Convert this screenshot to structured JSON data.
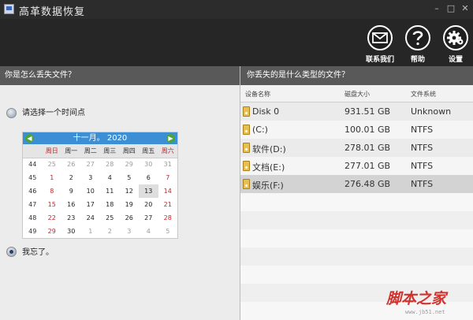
{
  "app": {
    "title": "高革数据恢复"
  },
  "window": {
    "minimize": "–",
    "maximize": "□",
    "close": "✕"
  },
  "toolbar": [
    {
      "id": "contact",
      "label": "联系我们",
      "icon": "mail-icon"
    },
    {
      "id": "help",
      "label": "帮助",
      "icon": "help-icon"
    },
    {
      "id": "settings",
      "label": "设置",
      "icon": "gear-icon"
    }
  ],
  "left_header": "你是怎么丢失文件？",
  "right_header": "你丢失的是什么类型的文件？",
  "options": {
    "timepoint": "请选择一个时间点",
    "forgot": "我忘了。"
  },
  "calendar": {
    "title": "十一月。 2020",
    "weekdays": [
      "周日",
      "周一",
      "周二",
      "周三",
      "周四",
      "周五",
      "周六"
    ],
    "weeks": [
      {
        "no": "44",
        "days": [
          "25",
          "26",
          "27",
          "28",
          "29",
          "30",
          "31"
        ]
      },
      {
        "no": "45",
        "days": [
          "1",
          "2",
          "3",
          "4",
          "5",
          "6",
          "7"
        ]
      },
      {
        "no": "46",
        "days": [
          "8",
          "9",
          "10",
          "11",
          "12",
          "13",
          "14"
        ]
      },
      {
        "no": "47",
        "days": [
          "15",
          "16",
          "17",
          "18",
          "19",
          "20",
          "21"
        ]
      },
      {
        "no": "48",
        "days": [
          "22",
          "23",
          "24",
          "25",
          "26",
          "27",
          "28"
        ]
      },
      {
        "no": "49",
        "days": [
          "29",
          "30",
          "1",
          "2",
          "3",
          "4",
          "5"
        ]
      }
    ],
    "selected_day": "13"
  },
  "table": {
    "headers": [
      "设备名称",
      "磁盘大小",
      "文件系统"
    ],
    "rows": [
      {
        "name": "Disk 0",
        "size": "931.51 GB",
        "fs": "Unknown"
      },
      {
        "name": "(C:)",
        "size": "100.01 GB",
        "fs": "NTFS"
      },
      {
        "name": "软件(D:)",
        "size": "278.01 GB",
        "fs": "NTFS"
      },
      {
        "name": "文档(E:)",
        "size": "277.01 GB",
        "fs": "NTFS"
      },
      {
        "name": "娱乐(F:)",
        "size": "276.48 GB",
        "fs": "NTFS"
      }
    ]
  },
  "watermark": {
    "text": "脚本之家",
    "url": "www.jb51.net"
  }
}
